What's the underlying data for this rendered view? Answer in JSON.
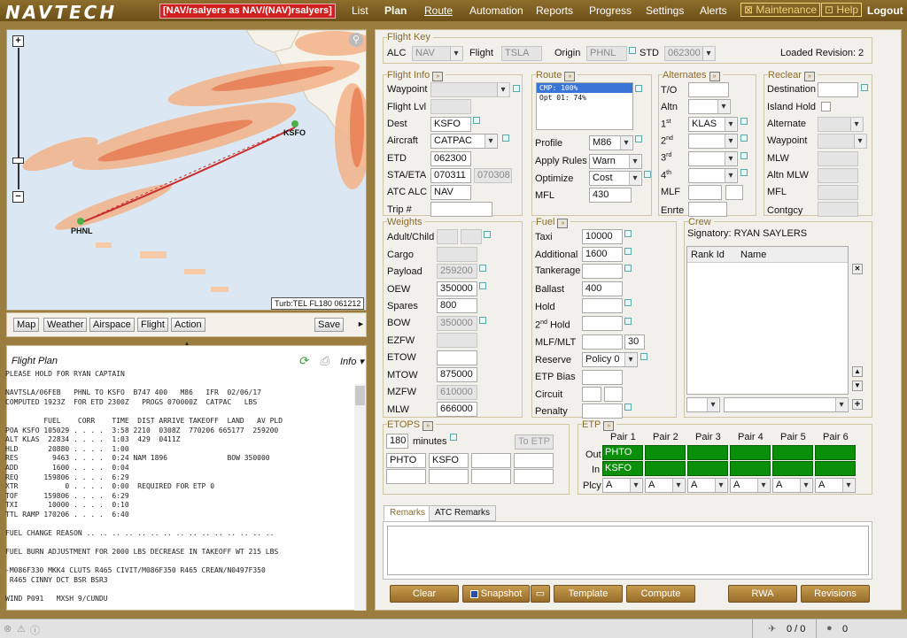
{
  "header": {
    "logo": "NAVTECH",
    "user": "[NAV/rsalyers as NAV/(NAV)rsalyers]",
    "nav": [
      "List",
      "Plan",
      "Route",
      "Automation",
      "Reports",
      "Progress",
      "Settings",
      "Alerts",
      "Maintenance",
      "Help",
      "Logout"
    ]
  },
  "map": {
    "labels": {
      "dest": "KSFO",
      "orig": "PHNL"
    },
    "info": "Turb:TEL FL180 061212",
    "buttons": [
      "Map",
      "Weather",
      "Airspace",
      "Flight",
      "Action"
    ],
    "save": "Save"
  },
  "flight_plan": {
    "title": "Flight Plan",
    "info": "Info",
    "lines": [
      "PLEASE HOLD FOR RYAN CAPTAIN",
      "",
      "NAVTSLA/06FEB   PHNL TO KSFO  B747 400   M86   IFR  02/06/17",
      "COMPUTED 1923Z  FOR ETD 2300Z   PROGS 070000Z  CATPAC   LBS",
      "",
      "         FUEL    CORR    TIME  DIST ARRIVE TAKEOFF  LAND   AV PLD",
      "POA KSFO 105029 . . . .  3:58 2210  0308Z  770206 665177  259200",
      "ALT KLAS  22834 . . . .  1:03  429  0411Z",
      "HLD       20880 . . . .  1:00",
      "RES        9463 . . . .  0:24 NAM 1896              BOW 350000",
      "ADD        1600 . . . .  0:04",
      "REQ      159806 . . . .  6:29",
      "XTR           0 . . . .  0:00  REQUIRED FOR ETP 0",
      "TOF      159806 . . . .  6:29",
      "TXI       10000 . . . .  0:10",
      "TTL RAMP 170206 . . . .  6:40",
      "",
      "FUEL CHANGE REASON .. .. .. .. .. .. .. .. .. .. .. .. .. .. ..",
      "",
      "FUEL BURN ADJUSTMENT FOR 2000 LBS DECREASE IN TAKEOFF WT 215 LBS",
      "",
      "-M086F330 MKK4 CLUTS R465 CIVIT/M086F350 R465 CREAN/N0497F350",
      " R465 CINNY DCT BSR BSR3",
      "",
      "WIND P091   MXSH 9/CUNDU"
    ]
  },
  "flight_key": {
    "title": "Flight Key",
    "alc_label": "ALC",
    "alc": "NAV",
    "flight_label": "Flight",
    "flight": "TSLA",
    "origin_label": "Origin",
    "origin": "PHNL",
    "std_label": "STD",
    "std": "062300",
    "revision": "Loaded Revision: 2"
  },
  "flight_info": {
    "title": "Flight Info",
    "waypoint": "Waypoint",
    "flight_lvl": "Flight Lvl",
    "dest": "Dest",
    "dest_val": "KSFO",
    "aircraft": "Aircraft",
    "aircraft_val": "CATPAC",
    "etd": "ETD",
    "etd_val": "062300",
    "sta": "STA/ETA",
    "sta_val": "070311",
    "eta_val": "070308",
    "atc": "ATC ALC",
    "atc_val": "NAV",
    "trip": "Trip #"
  },
  "route": {
    "title": "Route",
    "options": [
      "CMP: 100%",
      "Opt 01: 74%"
    ],
    "profile": "Profile",
    "profile_val": "M86",
    "apply": "Apply Rules",
    "apply_val": "Warn",
    "optimize": "Optimize",
    "optimize_val": "Cost",
    "mfl": "MFL",
    "mfl_val": "430"
  },
  "alternates": {
    "title": "Alternates",
    "to": "T/O",
    "altn": "Altn",
    "first": "1",
    "first_sup": "st",
    "first_val": "KLAS",
    "second": "2",
    "second_sup": "nd",
    "third": "3",
    "third_sup": "rd",
    "fourth": "4",
    "fourth_sup": "th",
    "mlf": "MLF",
    "enrte": "Enrte"
  },
  "reclear": {
    "title": "Reclear",
    "destination": "Destination",
    "island": "Island Hold",
    "alternate": "Alternate",
    "waypoint": "Waypoint",
    "mlw": "MLW",
    "altn_mlw": "Altn MLW",
    "mfl": "MFL",
    "contgcy": "Contgcy"
  },
  "weights": {
    "title": "Weights",
    "adult": "Adult/Child",
    "cargo": "Cargo",
    "payload": "Payload",
    "payload_val": "259200",
    "oew": "OEW",
    "oew_val": "350000",
    "spares": "Spares",
    "spares_val": "800",
    "bow": "BOW",
    "bow_val": "350000",
    "ezfw": "EZFW",
    "etow": "ETOW",
    "mtow": "MTOW",
    "mtow_val": "875000",
    "mzfw": "MZFW",
    "mzfw_val": "610000",
    "mlw": "MLW",
    "mlw_val": "666000"
  },
  "fuel": {
    "title": "Fuel",
    "taxi": "Taxi",
    "taxi_val": "10000",
    "additional": "Additional",
    "additional_val": "1600",
    "tankerage": "Tankerage",
    "ballast": "Ballast",
    "ballast_val": "400",
    "hold": "Hold",
    "hold2": "2",
    "hold2_sup": "nd",
    "hold2_txt": " Hold",
    "mlf": "MLF/MLT",
    "mlf_val": "30",
    "reserve": "Reserve",
    "reserve_val": "Policy 0",
    "etp_bias": "ETP Bias",
    "circuit": "Circuit",
    "penalty": "Penalty"
  },
  "crew": {
    "title": "Crew",
    "signatory": "Signatory: RYAN SAYLERS",
    "col1": "Rank Id",
    "col2": "Name"
  },
  "etops": {
    "title": "ETOPS",
    "minutes_val": "180",
    "minutes": "minutes",
    "to_etp": "To ETP",
    "a1": "PHTO",
    "a2": "KSFO"
  },
  "etp": {
    "title": "ETP",
    "pairs": [
      "Pair 1",
      "Pair 2",
      "Pair 3",
      "Pair 4",
      "Pair 5",
      "Pair 6"
    ],
    "out": "Out",
    "in": "In",
    "plcy": "Plcy",
    "out1": "PHTO",
    "in1": "KSFO",
    "plcy_val": "A"
  },
  "remarks": {
    "tab1": "Remarks",
    "tab2": "ATC Remarks"
  },
  "buttons": {
    "clear": "Clear",
    "snapshot": "Snapshot",
    "template": "Template",
    "compute": "Compute",
    "rwa": "RWA",
    "revisions": "Revisions"
  },
  "status": {
    "count1": "0 / 0",
    "count2": "0"
  }
}
